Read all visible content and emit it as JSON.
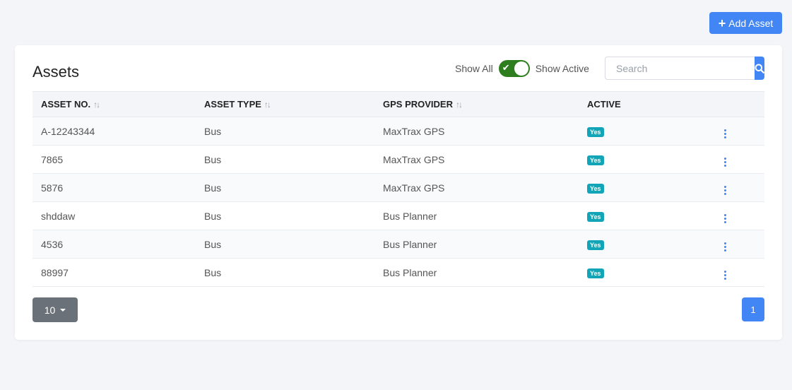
{
  "toolbar": {
    "add_label": "Add Asset"
  },
  "card": {
    "title": "Assets"
  },
  "filter": {
    "show_all": "Show All",
    "show_active": "Show Active",
    "toggle_on": true
  },
  "search": {
    "placeholder": "Search",
    "value": ""
  },
  "table": {
    "headers": [
      "ASSET NO.",
      "ASSET TYPE",
      "GPS PROVIDER",
      "ACTIVE"
    ],
    "rows": [
      {
        "asset_no": "A-12243344",
        "asset_type": "Bus",
        "gps_provider": "MaxTrax GPS",
        "active": "Yes"
      },
      {
        "asset_no": "7865",
        "asset_type": "Bus",
        "gps_provider": "MaxTrax GPS",
        "active": "Yes"
      },
      {
        "asset_no": "5876",
        "asset_type": "Bus",
        "gps_provider": "MaxTrax GPS",
        "active": "Yes"
      },
      {
        "asset_no": "shddaw",
        "asset_type": "Bus",
        "gps_provider": "Bus Planner",
        "active": "Yes"
      },
      {
        "asset_no": "4536",
        "asset_type": "Bus",
        "gps_provider": "Bus Planner",
        "active": "Yes"
      },
      {
        "asset_no": "88997",
        "asset_type": "Bus",
        "gps_provider": "Bus Planner",
        "active": "Yes"
      }
    ]
  },
  "pagination": {
    "page_size": "10",
    "current_page": "1"
  },
  "colors": {
    "primary": "#4285f4",
    "toggle": "#2e7d1e",
    "badge": "#12a5b7",
    "secondary": "#6b7178",
    "background": "#f4f5f9"
  },
  "icons": {
    "add": "plus-icon",
    "search": "search-icon",
    "sort": "sort-arrows-icon",
    "row_menu": "kebab-menu-icon",
    "caret": "caret-down-icon",
    "toggle": "check-icon"
  }
}
